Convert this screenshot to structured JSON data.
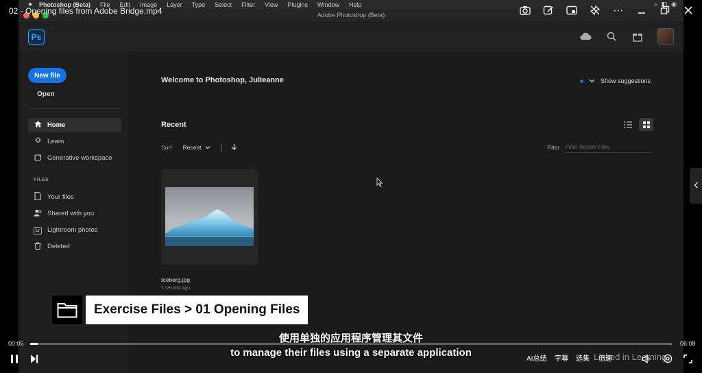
{
  "player": {
    "title": "02 - Opening files from Adobe Bridge.mp4",
    "current_time": "00:05",
    "total_time": "06:08",
    "progress_fraction": 0.012,
    "controls": {
      "ai_summary": "AI总结",
      "subtitles": "字幕",
      "episodes": "选集",
      "speed": "倍速"
    },
    "watermark": "Linked in Learning"
  },
  "mac_menu": {
    "app_name": "Photoshop (Beta)",
    "items": [
      "File",
      "Edit",
      "Image",
      "Layer",
      "Type",
      "Select",
      "Filter",
      "View",
      "Plugins",
      "Window",
      "Help"
    ]
  },
  "window": {
    "title": "Adobe Photoshop (Beta)"
  },
  "app": {
    "logo": "Ps"
  },
  "sidebar": {
    "new_file": "New file",
    "open": "Open",
    "nav": [
      {
        "label": "Home",
        "icon": "home-icon"
      },
      {
        "label": "Learn",
        "icon": "lightbulb-icon"
      },
      {
        "label": "Generative workspace",
        "icon": "generative-icon"
      }
    ],
    "files_heading": "FILES",
    "files": [
      {
        "label": "Your files",
        "icon": "file-icon"
      },
      {
        "label": "Shared with you",
        "icon": "shared-icon"
      },
      {
        "label": "Lightroom photos",
        "icon": "lightroom-icon",
        "badge": "Lr"
      },
      {
        "label": "Deleted",
        "icon": "trash-icon"
      }
    ]
  },
  "main": {
    "welcome": "Welcome to Photoshop, Julieanne",
    "show_suggestions": "Show suggestions",
    "recent_title": "Recent",
    "sort_label": "Sort",
    "sort_value": "Recent",
    "filter_label": "Filter",
    "filter_placeholder": "Filter Recent Files",
    "recent_files": [
      {
        "name": "Iceberg.jpg",
        "time": "1 second ago"
      }
    ]
  },
  "overlay": {
    "exercise_files": "Exercise Files > 01 Opening Files"
  },
  "subtitles": {
    "cn": "使用单独的应用程序管理其文件",
    "en": "to manage their files using a separate application"
  },
  "colors": {
    "accent_blue": "#1473e6",
    "ps_blue": "#31a8ff",
    "app_bg": "#1b1b1b"
  }
}
